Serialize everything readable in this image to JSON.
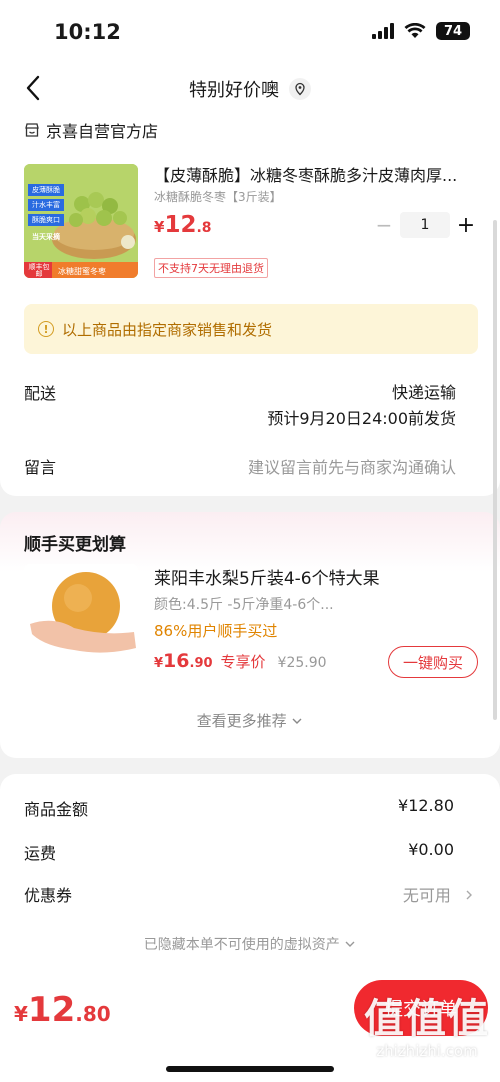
{
  "status": {
    "time": "10:12",
    "battery": "74",
    "wifi_icon": "wifi-icon",
    "signal_icon": "signal-icon"
  },
  "nav": {
    "title": "特别好价噢",
    "back_icon": "chevron-left-icon",
    "location_icon": "location-pin-icon"
  },
  "shop": {
    "name": "京喜自营官方店",
    "icon": "store-icon"
  },
  "product": {
    "title": "【皮薄酥脆】冰糖冬枣酥脆多汁皮薄肉厚...",
    "spec": "冰糖酥脆冬枣【3斤装】",
    "price_currency": "¥",
    "price_int": "12",
    "price_dec": ".8",
    "quantity": "1",
    "minus": "−",
    "plus": "+",
    "refund_tag": "不支持7天无理由退货",
    "image_labels": {
      "badge1": "皮薄酥脆",
      "badge2": "汁水丰富",
      "badge3": "酥脆爽口",
      "badge4": "当天采摘",
      "bottom_left": "顺丰包邮",
      "bottom_right": "冰糖甜蜜冬枣"
    }
  },
  "notice": {
    "text": "以上商品由指定商家销售和发货",
    "icon": "info-icon"
  },
  "delivery": {
    "label": "配送",
    "method": "快递运输",
    "eta": "预计9月20日24:00前发货"
  },
  "message": {
    "label": "留言",
    "placeholder": "建议留言前先与商家沟通确认"
  },
  "recommend": {
    "title": "顺手买更划算",
    "name": "莱阳丰水梨5斤装4-6个特大果",
    "spec": "颜色:4.5斤 -5斤净重4-6个...",
    "stat": "86%用户顺手买过",
    "price_currency": "¥",
    "price_int": "16",
    "price_dec": ".90",
    "exclusive": "专享价",
    "orig_price": "¥25.90",
    "buy_label": "一键购买",
    "more": "查看更多推荐"
  },
  "summary": {
    "items": [
      {
        "label": "商品金额",
        "value": "¥12.80"
      },
      {
        "label": "运费",
        "value": "¥0.00"
      },
      {
        "label": "优惠券",
        "value": "无可用"
      }
    ],
    "hidden_assets": "已隐藏本单不可使用的虚拟资产"
  },
  "footer": {
    "total_currency": "¥",
    "total_int": "12",
    "total_dec": ".80",
    "submit": "提交订单",
    "watermark_logo": "值值值",
    "watermark_url": "zhizhizhi.com"
  },
  "colors": {
    "accent": "#e4393c",
    "notice_bg": "#fdf5d8",
    "notice_text": "#b06d00"
  }
}
